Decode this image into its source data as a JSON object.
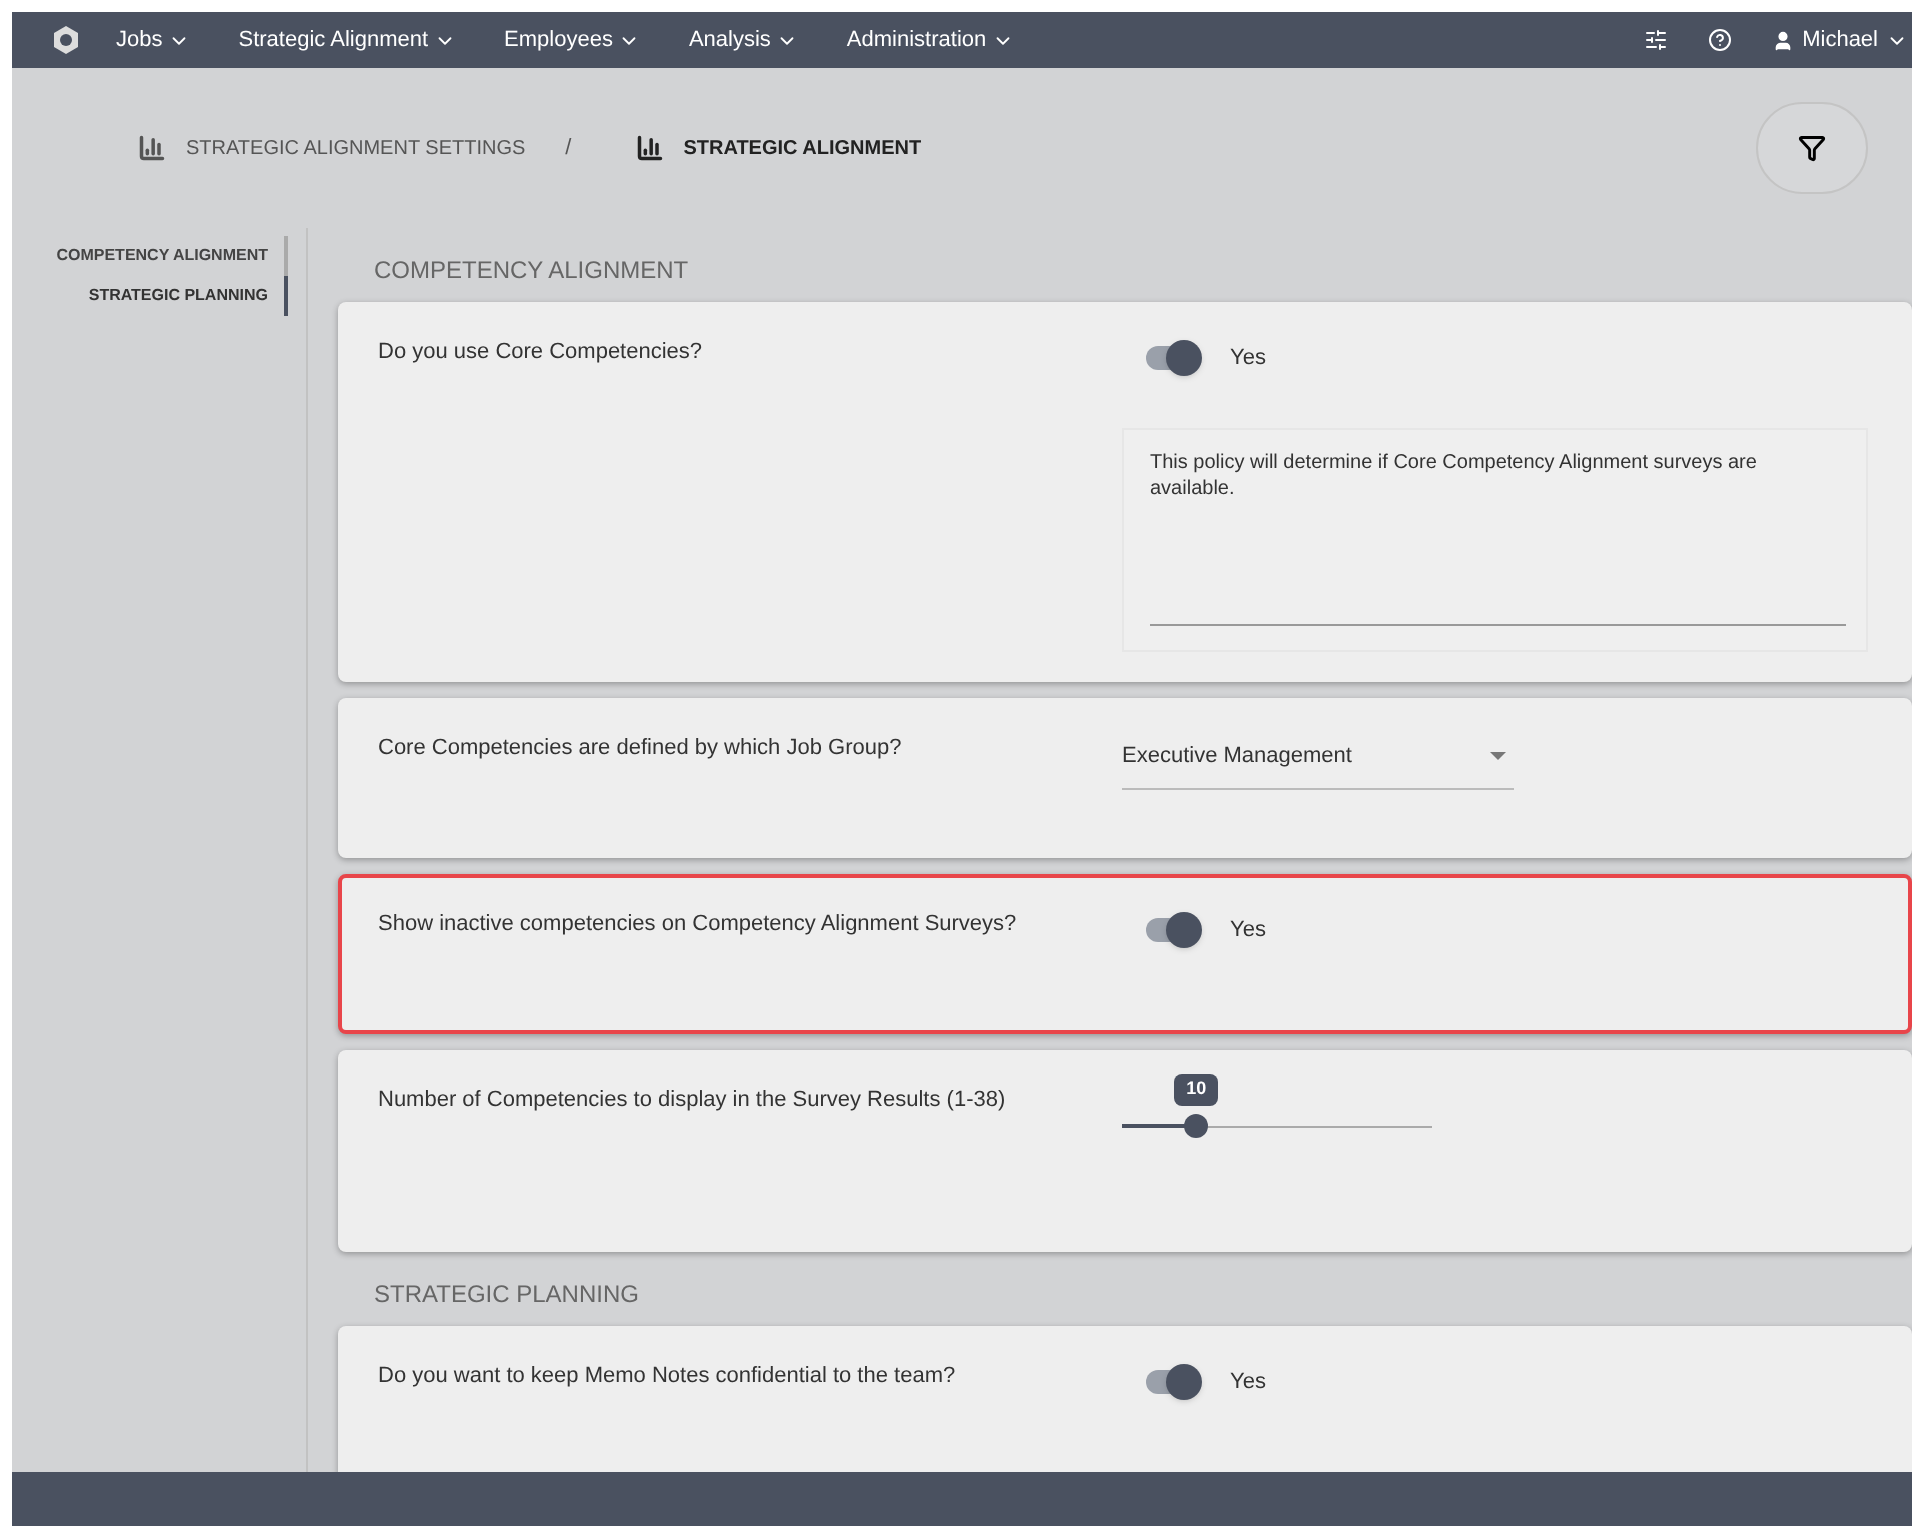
{
  "nav": {
    "items": [
      {
        "label": "Jobs"
      },
      {
        "label": "Strategic Alignment"
      },
      {
        "label": "Employees"
      },
      {
        "label": "Analysis"
      },
      {
        "label": "Administration"
      }
    ],
    "user": "Michael"
  },
  "breadcrumb": [
    {
      "label": "STRATEGIC ALIGNMENT SETTINGS",
      "selected": false
    },
    {
      "label": "/",
      "kind": "separator"
    },
    {
      "label": "STRATEGIC ALIGNMENT",
      "selected": true
    }
  ],
  "sidebar": {
    "items": [
      {
        "label": "COMPETENCY ALIGNMENT",
        "selected": false
      },
      {
        "label": "STRATEGIC PLANNING",
        "selected": true
      }
    ]
  },
  "sections": [
    {
      "title": "COMPETENCY ALIGNMENT",
      "settings": [
        {
          "kind": "toggle",
          "question": "Do you use Core Competencies?",
          "on": true,
          "value": "Yes",
          "note": "This policy will determine if Core Competency Alignment surveys are available.",
          "highlighted": false
        },
        {
          "kind": "select",
          "question": "Core Competencies are defined by which Job Group?",
          "value": "Executive Management",
          "highlighted": false
        },
        {
          "kind": "toggle",
          "question": "Show inactive competencies on Competency Alignment Surveys?",
          "on": true,
          "value": "Yes",
          "highlighted": true
        },
        {
          "kind": "slider",
          "question": "Number of Competencies to display in the Survey Results (1-38)",
          "level": 0.24,
          "value": "10",
          "highlighted": false
        }
      ]
    },
    {
      "title": "STRATEGIC PLANNING",
      "settings": [
        {
          "kind": "toggle",
          "question": "Do you want to keep Memo Notes confidential to the team?",
          "on": true,
          "value": "Yes",
          "highlighted": false
        }
      ]
    }
  ]
}
